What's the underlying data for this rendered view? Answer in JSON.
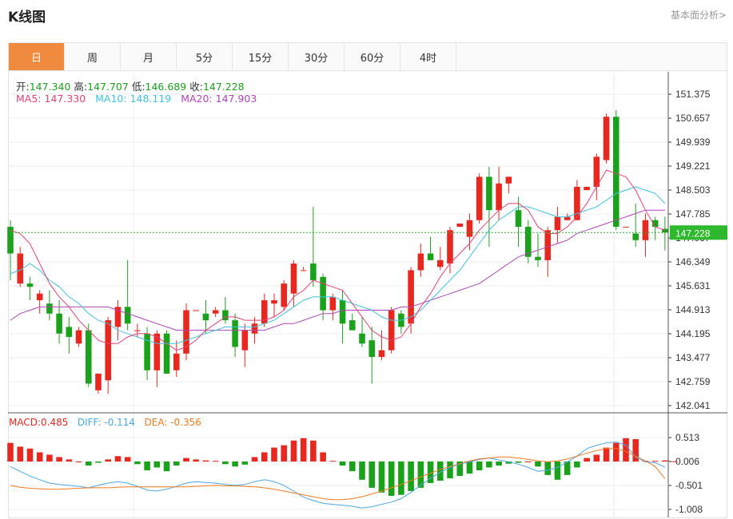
{
  "header": {
    "title": "K线图",
    "link": "基本面分析>"
  },
  "tabs": [
    "日",
    "周",
    "月",
    "5分",
    "15分",
    "30分",
    "60分",
    "4时"
  ],
  "active_tab": 0,
  "colors": {
    "up": "#e8271f",
    "down": "#1aa31a",
    "ma5": "#e8407a",
    "ma10": "#3ec3e0",
    "ma20": "#b045b8",
    "diff": "#4aa8e8",
    "dea": "#f07a1e",
    "accent": "#f08a3c",
    "price_tag": "#2eb82e"
  },
  "ohlc_info": {
    "open_label": "开:",
    "open": "147.340",
    "high_label": "高:",
    "high": "147.707",
    "low_label": "低:",
    "low": "146.689",
    "close_label": "收:",
    "close": "147.228"
  },
  "ma_info": {
    "ma5_label": "MA5:",
    "ma5": "147.330",
    "ma10_label": "MA10:",
    "ma10": "148.119",
    "ma20_label": "MA20:",
    "ma20": "147.903"
  },
  "macd_info": {
    "macd_label": "MACD:",
    "macd": "0.485",
    "diff_label": "DIFF:",
    "diff": "-0.114",
    "dea_label": "DEA:",
    "dea": "-0.356"
  },
  "chart_data": [
    {
      "type": "candlestick",
      "y_ticks": [
        "151.375",
        "150.657",
        "149.939",
        "149.221",
        "148.503",
        "147.785",
        "147.067",
        "146.349",
        "145.631",
        "144.913",
        "144.195",
        "143.477",
        "142.759",
        "142.041"
      ],
      "ylim": [
        142.041,
        151.375
      ],
      "last_price": "147.228",
      "candles": [
        {
          "o": 147.4,
          "h": 147.6,
          "l": 145.8,
          "c": 146.6
        },
        {
          "o": 145.7,
          "h": 146.8,
          "l": 145.6,
          "c": 146.6
        },
        {
          "o": 145.7,
          "h": 145.9,
          "l": 145.2,
          "c": 145.6
        },
        {
          "o": 145.2,
          "h": 145.5,
          "l": 144.8,
          "c": 145.4
        },
        {
          "o": 145.1,
          "h": 145.5,
          "l": 144.6,
          "c": 144.8
        },
        {
          "o": 144.8,
          "h": 145.2,
          "l": 143.9,
          "c": 144.2
        },
        {
          "o": 144.4,
          "h": 144.7,
          "l": 143.6,
          "c": 144.1
        },
        {
          "o": 143.9,
          "h": 144.4,
          "l": 143.8,
          "c": 144.3
        },
        {
          "o": 144.3,
          "h": 144.5,
          "l": 142.6,
          "c": 142.7
        },
        {
          "o": 142.5,
          "h": 143.0,
          "l": 142.4,
          "c": 143.0
        },
        {
          "o": 142.8,
          "h": 144.7,
          "l": 142.4,
          "c": 144.6
        },
        {
          "o": 144.4,
          "h": 145.2,
          "l": 144.0,
          "c": 145.0
        },
        {
          "o": 145.0,
          "h": 146.4,
          "l": 144.3,
          "c": 144.5
        },
        {
          "o": 144.3,
          "h": 144.5,
          "l": 144.1,
          "c": 144.3
        },
        {
          "o": 144.2,
          "h": 144.4,
          "l": 142.8,
          "c": 143.1
        },
        {
          "o": 143.1,
          "h": 144.3,
          "l": 142.6,
          "c": 144.2
        },
        {
          "o": 144.2,
          "h": 144.3,
          "l": 143.0,
          "c": 143.0
        },
        {
          "o": 143.1,
          "h": 144.0,
          "l": 142.9,
          "c": 143.6
        },
        {
          "o": 143.6,
          "h": 145.1,
          "l": 143.4,
          "c": 144.9
        },
        {
          "o": 144.9,
          "h": 144.9,
          "l": 144.9,
          "c": 144.9
        },
        {
          "o": 144.8,
          "h": 145.2,
          "l": 144.2,
          "c": 144.6
        },
        {
          "o": 144.8,
          "h": 145.0,
          "l": 144.7,
          "c": 144.9
        },
        {
          "o": 144.9,
          "h": 145.3,
          "l": 144.5,
          "c": 144.6
        },
        {
          "o": 144.6,
          "h": 144.8,
          "l": 143.5,
          "c": 143.8
        },
        {
          "o": 143.7,
          "h": 144.5,
          "l": 143.2,
          "c": 144.3
        },
        {
          "o": 144.2,
          "h": 144.7,
          "l": 143.9,
          "c": 144.5
        },
        {
          "o": 144.5,
          "h": 145.4,
          "l": 144.4,
          "c": 145.2
        },
        {
          "o": 145.1,
          "h": 145.4,
          "l": 144.7,
          "c": 145.2
        },
        {
          "o": 145.0,
          "h": 145.8,
          "l": 144.9,
          "c": 145.7
        },
        {
          "o": 145.4,
          "h": 146.4,
          "l": 145.0,
          "c": 146.3
        },
        {
          "o": 146.1,
          "h": 146.2,
          "l": 146.1,
          "c": 146.1
        },
        {
          "o": 146.3,
          "h": 148.0,
          "l": 145.6,
          "c": 145.8
        },
        {
          "o": 145.9,
          "h": 146.0,
          "l": 144.6,
          "c": 144.9
        },
        {
          "o": 144.9,
          "h": 145.4,
          "l": 144.6,
          "c": 145.3
        },
        {
          "o": 145.2,
          "h": 145.5,
          "l": 143.9,
          "c": 144.5
        },
        {
          "o": 144.6,
          "h": 144.8,
          "l": 144.3,
          "c": 144.3
        },
        {
          "o": 144.2,
          "h": 144.7,
          "l": 143.8,
          "c": 143.9
        },
        {
          "o": 144.0,
          "h": 144.4,
          "l": 142.7,
          "c": 143.5
        },
        {
          "o": 143.5,
          "h": 144.3,
          "l": 143.4,
          "c": 143.7
        },
        {
          "o": 143.7,
          "h": 145.0,
          "l": 143.6,
          "c": 144.9
        },
        {
          "o": 144.8,
          "h": 144.9,
          "l": 144.2,
          "c": 144.4
        },
        {
          "o": 144.5,
          "h": 146.2,
          "l": 144.2,
          "c": 146.1
        },
        {
          "o": 146.1,
          "h": 146.9,
          "l": 145.9,
          "c": 146.6
        },
        {
          "o": 146.6,
          "h": 147.1,
          "l": 146.4,
          "c": 146.4
        },
        {
          "o": 146.2,
          "h": 146.8,
          "l": 146.1,
          "c": 146.4
        },
        {
          "o": 146.3,
          "h": 147.4,
          "l": 146.0,
          "c": 147.3
        },
        {
          "o": 147.4,
          "h": 147.5,
          "l": 147.4,
          "c": 147.5
        },
        {
          "o": 147.1,
          "h": 147.8,
          "l": 146.7,
          "c": 147.6
        },
        {
          "o": 147.6,
          "h": 149.0,
          "l": 147.5,
          "c": 148.9
        },
        {
          "o": 148.9,
          "h": 149.2,
          "l": 146.8,
          "c": 147.9
        },
        {
          "o": 147.9,
          "h": 149.2,
          "l": 147.6,
          "c": 148.7
        },
        {
          "o": 148.7,
          "h": 148.9,
          "l": 148.4,
          "c": 148.9
        },
        {
          "o": 147.9,
          "h": 148.3,
          "l": 146.8,
          "c": 147.4
        },
        {
          "o": 147.4,
          "h": 147.6,
          "l": 146.3,
          "c": 146.5
        },
        {
          "o": 146.5,
          "h": 147.2,
          "l": 146.2,
          "c": 146.4
        },
        {
          "o": 146.4,
          "h": 147.4,
          "l": 145.9,
          "c": 147.3
        },
        {
          "o": 147.3,
          "h": 148.0,
          "l": 146.9,
          "c": 147.7
        },
        {
          "o": 147.6,
          "h": 147.8,
          "l": 147.6,
          "c": 147.7
        },
        {
          "o": 147.6,
          "h": 148.8,
          "l": 147.6,
          "c": 148.6
        },
        {
          "o": 148.5,
          "h": 148.6,
          "l": 148.5,
          "c": 148.6
        },
        {
          "o": 148.6,
          "h": 149.6,
          "l": 148.2,
          "c": 149.5
        },
        {
          "o": 149.4,
          "h": 150.8,
          "l": 149.3,
          "c": 150.7
        },
        {
          "o": 150.7,
          "h": 150.9,
          "l": 147.3,
          "c": 147.4
        },
        {
          "o": 147.4,
          "h": 147.4,
          "l": 147.4,
          "c": 147.4
        },
        {
          "o": 147.2,
          "h": 148.1,
          "l": 146.8,
          "c": 147.0
        },
        {
          "o": 147.0,
          "h": 147.8,
          "l": 146.5,
          "c": 147.6
        },
        {
          "o": 147.6,
          "h": 147.7,
          "l": 147.0,
          "c": 147.4
        },
        {
          "o": 147.34,
          "h": 147.707,
          "l": 146.689,
          "c": 147.228
        }
      ],
      "ma5": [
        147.3,
        147.2,
        146.9,
        146.3,
        145.7,
        145.3,
        145.0,
        144.6,
        144.3,
        144.0,
        143.9,
        143.9,
        144.1,
        144.2,
        144.2,
        144.1,
        143.9,
        143.7,
        143.8,
        144.0,
        144.3,
        144.5,
        144.7,
        144.7,
        144.6,
        144.6,
        144.6,
        144.7,
        144.9,
        145.3,
        145.5,
        145.8,
        145.7,
        145.6,
        145.5,
        145.1,
        144.7,
        144.3,
        144.1,
        144.0,
        144.1,
        144.5,
        145.0,
        145.4,
        145.9,
        146.3,
        146.6,
        146.9,
        147.3,
        147.6,
        147.9,
        148.1,
        148.1,
        147.9,
        147.4,
        147.2,
        147.2,
        147.4,
        147.7,
        148.1,
        148.6,
        149.1,
        149.0,
        148.9,
        148.5,
        147.9,
        147.4,
        147.3
      ],
      "ma10": [
        146.0,
        146.1,
        146.3,
        146.1,
        145.8,
        145.6,
        145.3,
        145.1,
        144.8,
        144.6,
        144.5,
        144.3,
        144.2,
        144.1,
        144.0,
        143.9,
        143.9,
        143.9,
        144.0,
        144.1,
        144.2,
        144.3,
        144.4,
        144.4,
        144.4,
        144.4,
        144.5,
        144.6,
        144.8,
        145.0,
        145.2,
        145.3,
        145.3,
        145.3,
        145.2,
        145.1,
        145.0,
        144.9,
        144.7,
        144.6,
        144.6,
        144.7,
        144.9,
        145.2,
        145.5,
        145.8,
        146.1,
        146.5,
        146.9,
        147.3,
        147.6,
        147.8,
        148.0,
        148.0,
        147.9,
        147.8,
        147.7,
        147.7,
        147.8,
        147.9,
        148.0,
        148.2,
        148.4,
        148.5,
        148.6,
        148.5,
        148.4,
        148.1
      ],
      "ma20": [
        144.6,
        144.8,
        144.9,
        145.0,
        145.0,
        145.0,
        145.0,
        145.0,
        145.0,
        145.0,
        145.0,
        144.9,
        144.8,
        144.7,
        144.6,
        144.5,
        144.4,
        144.3,
        144.3,
        144.3,
        144.3,
        144.3,
        144.3,
        144.3,
        144.3,
        144.3,
        144.3,
        144.4,
        144.5,
        144.5,
        144.6,
        144.7,
        144.8,
        144.8,
        144.9,
        144.9,
        144.9,
        144.9,
        144.9,
        144.9,
        145.0,
        145.0,
        145.1,
        145.2,
        145.3,
        145.4,
        145.5,
        145.6,
        145.7,
        145.9,
        146.1,
        146.3,
        146.5,
        146.6,
        146.7,
        146.8,
        146.9,
        147.0,
        147.2,
        147.3,
        147.4,
        147.5,
        147.6,
        147.7,
        147.8,
        147.9,
        147.9,
        147.9
      ]
    },
    {
      "type": "macd",
      "y_ticks": [
        "0.513",
        "0.006",
        "-0.501",
        "-1.008"
      ],
      "ylim": [
        -1.008,
        0.513
      ],
      "bars": [
        0.4,
        0.32,
        0.28,
        0.2,
        0.15,
        0.1,
        0.05,
        0.0,
        -0.08,
        -0.02,
        0.05,
        0.12,
        0.1,
        -0.05,
        -0.18,
        -0.12,
        -0.2,
        -0.08,
        0.08,
        0.05,
        0.03,
        0.02,
        -0.05,
        -0.1,
        -0.06,
        0.1,
        0.2,
        0.3,
        0.35,
        0.45,
        0.5,
        0.45,
        0.2,
        0.02,
        -0.08,
        -0.2,
        -0.38,
        -0.55,
        -0.65,
        -0.72,
        -0.7,
        -0.62,
        -0.55,
        -0.45,
        -0.4,
        -0.35,
        -0.3,
        -0.25,
        -0.18,
        -0.12,
        -0.08,
        -0.04,
        -0.02,
        0.0,
        -0.1,
        -0.28,
        -0.38,
        -0.28,
        -0.12,
        0.08,
        0.15,
        0.3,
        0.4,
        0.5,
        0.48,
        0.02,
        0.02,
        0.03,
        0.01
      ],
      "diff": [
        -0.1,
        -0.2,
        -0.3,
        -0.38,
        -0.45,
        -0.48,
        -0.5,
        -0.52,
        -0.55,
        -0.5,
        -0.45,
        -0.42,
        -0.45,
        -0.52,
        -0.6,
        -0.62,
        -0.58,
        -0.52,
        -0.45,
        -0.42,
        -0.44,
        -0.45,
        -0.48,
        -0.5,
        -0.48,
        -0.42,
        -0.38,
        -0.42,
        -0.5,
        -0.62,
        -0.75,
        -0.82,
        -0.88,
        -0.9,
        -0.92,
        -0.94,
        -0.98,
        -0.95,
        -0.9,
        -0.85,
        -0.78,
        -0.65,
        -0.5,
        -0.35,
        -0.22,
        -0.12,
        -0.05,
        0.0,
        0.05,
        0.08,
        0.04,
        0.0,
        -0.05,
        -0.12,
        -0.2,
        -0.18,
        -0.12,
        0.0,
        0.12,
        0.28,
        0.35,
        0.4,
        0.42,
        0.35,
        0.1,
        0.0,
        -0.02,
        -0.114
      ],
      "dea": [
        -0.5,
        -0.54,
        -0.56,
        -0.57,
        -0.58,
        -0.58,
        -0.57,
        -0.56,
        -0.55,
        -0.55,
        -0.55,
        -0.54,
        -0.53,
        -0.53,
        -0.53,
        -0.53,
        -0.53,
        -0.53,
        -0.53,
        -0.52,
        -0.51,
        -0.5,
        -0.51,
        -0.51,
        -0.52,
        -0.53,
        -0.55,
        -0.58,
        -0.62,
        -0.66,
        -0.7,
        -0.74,
        -0.78,
        -0.8,
        -0.8,
        -0.78,
        -0.74,
        -0.68,
        -0.62,
        -0.55,
        -0.48,
        -0.4,
        -0.32,
        -0.24,
        -0.16,
        -0.1,
        -0.04,
        0.02,
        0.06,
        0.08,
        0.1,
        0.1,
        0.08,
        0.05,
        0.02,
        0.0,
        0.02,
        0.06,
        0.12,
        0.18,
        0.24,
        0.28,
        0.28,
        0.22,
        0.12,
        0.02,
        -0.1,
        -0.356
      ]
    }
  ]
}
